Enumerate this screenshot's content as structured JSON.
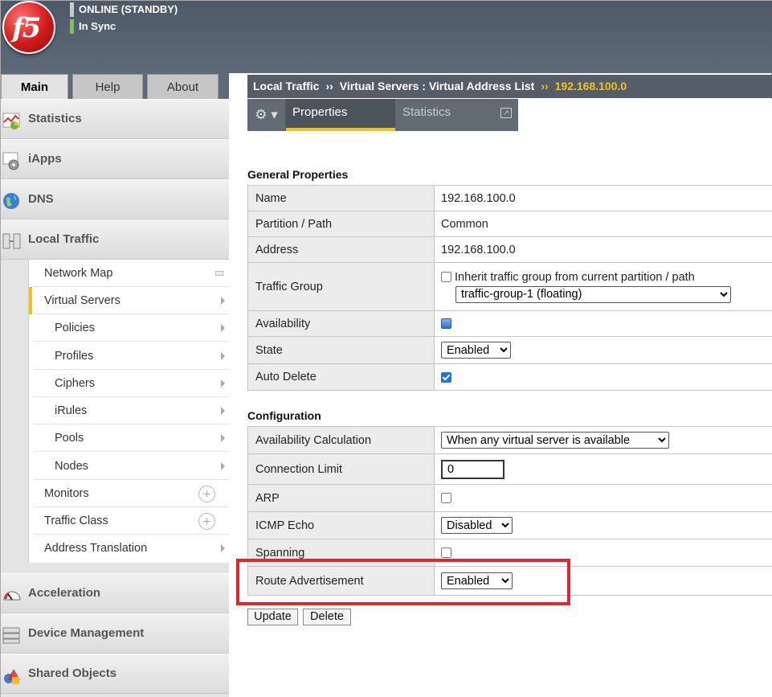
{
  "header": {
    "logo_text": "f5",
    "status_1": "ONLINE (STANDBY)",
    "status_2": "In Sync"
  },
  "main_tabs": [
    "Main",
    "Help",
    "About"
  ],
  "breadcrumb": {
    "part_1": "Local Traffic",
    "sep": "››",
    "part_2": "Virtual Servers : Virtual Address List",
    "current": "192.168.100.0"
  },
  "nav": {
    "sections": {
      "statistics": "Statistics",
      "iapps": "iApps",
      "dns": "DNS",
      "local_traffic": "Local Traffic",
      "acceleration": "Acceleration",
      "device_management": "Device Management",
      "shared_objects": "Shared Objects"
    },
    "sub": {
      "network_map": "Network Map",
      "virtual_servers": "Virtual Servers",
      "policies": "Policies",
      "profiles": "Profiles",
      "ciphers": "Ciphers",
      "irules": "iRules",
      "pools": "Pools",
      "nodes": "Nodes",
      "monitors": "Monitors",
      "traffic_class": "Traffic Class",
      "address_translation": "Address Translation"
    }
  },
  "page_tabs": {
    "gear": "⚙ ▾",
    "properties": "Properties",
    "statistics": "Statistics"
  },
  "general": {
    "title": "General Properties",
    "name_label": "Name",
    "name_value": "192.168.100.0",
    "partition_label": "Partition / Path",
    "partition_value": "Common",
    "address_label": "Address",
    "address_value": "192.168.100.0",
    "traffic_group_label": "Traffic Group",
    "inherit_label": "Inherit traffic group from current partition / path",
    "traffic_group_value": "traffic-group-1 (floating)",
    "availability_label": "Availability",
    "state_label": "State",
    "state_value": "Enabled",
    "auto_delete_label": "Auto Delete"
  },
  "configuration": {
    "title": "Configuration",
    "avail_calc_label": "Availability Calculation",
    "avail_calc_value": "When any virtual server is available",
    "conn_limit_label": "Connection Limit",
    "conn_limit_value": "0",
    "arp_label": "ARP",
    "icmp_label": "ICMP Echo",
    "icmp_value": "Disabled",
    "spanning_label": "Spanning",
    "route_adv_label": "Route Advertisement",
    "route_adv_value": "Enabled"
  },
  "buttons": {
    "update": "Update",
    "delete": "Delete"
  },
  "colors": {
    "accent": "#f2c11a",
    "header_bg": "#555e68",
    "highlight": "#e3262b"
  }
}
